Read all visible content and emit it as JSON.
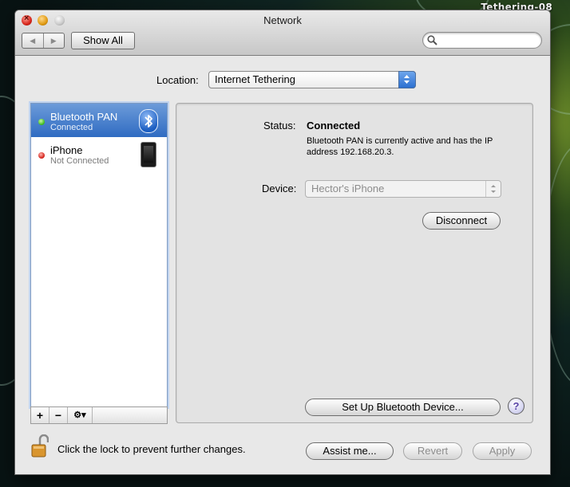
{
  "desktop": {
    "title": "Tethering-08"
  },
  "window": {
    "title": "Network"
  },
  "toolbar": {
    "back_glyph": "◀",
    "forward_glyph": "▶",
    "show_all_label": "Show All",
    "search_placeholder": ""
  },
  "location": {
    "label": "Location:",
    "value": "Internet Tethering"
  },
  "services": [
    {
      "name": "Bluetooth PAN",
      "status": "Connected",
      "status_color": "#37b817",
      "icon": "bluetooth-icon"
    },
    {
      "name": "iPhone",
      "status": "Not Connected",
      "status_color": "#d11a12",
      "icon": "iphone-icon"
    }
  ],
  "list_controls": {
    "add": "+",
    "remove": "−",
    "action": "⚙▾"
  },
  "detail": {
    "status_label": "Status:",
    "status_value": "Connected",
    "status_description": "Bluetooth PAN is currently active and has the IP address 192.168.20.3.",
    "device_label": "Device:",
    "device_value": "Hector's iPhone",
    "disconnect_label": "Disconnect",
    "setup_label": "Set Up Bluetooth Device...",
    "help_glyph": "?"
  },
  "footer": {
    "lock_text": "Click the lock to prevent further changes.",
    "assist_label": "Assist me...",
    "revert_label": "Revert",
    "apply_label": "Apply"
  },
  "colors": {
    "selection": "#2f6bc2",
    "connected": "#37b817",
    "disconnected": "#d11a12"
  }
}
